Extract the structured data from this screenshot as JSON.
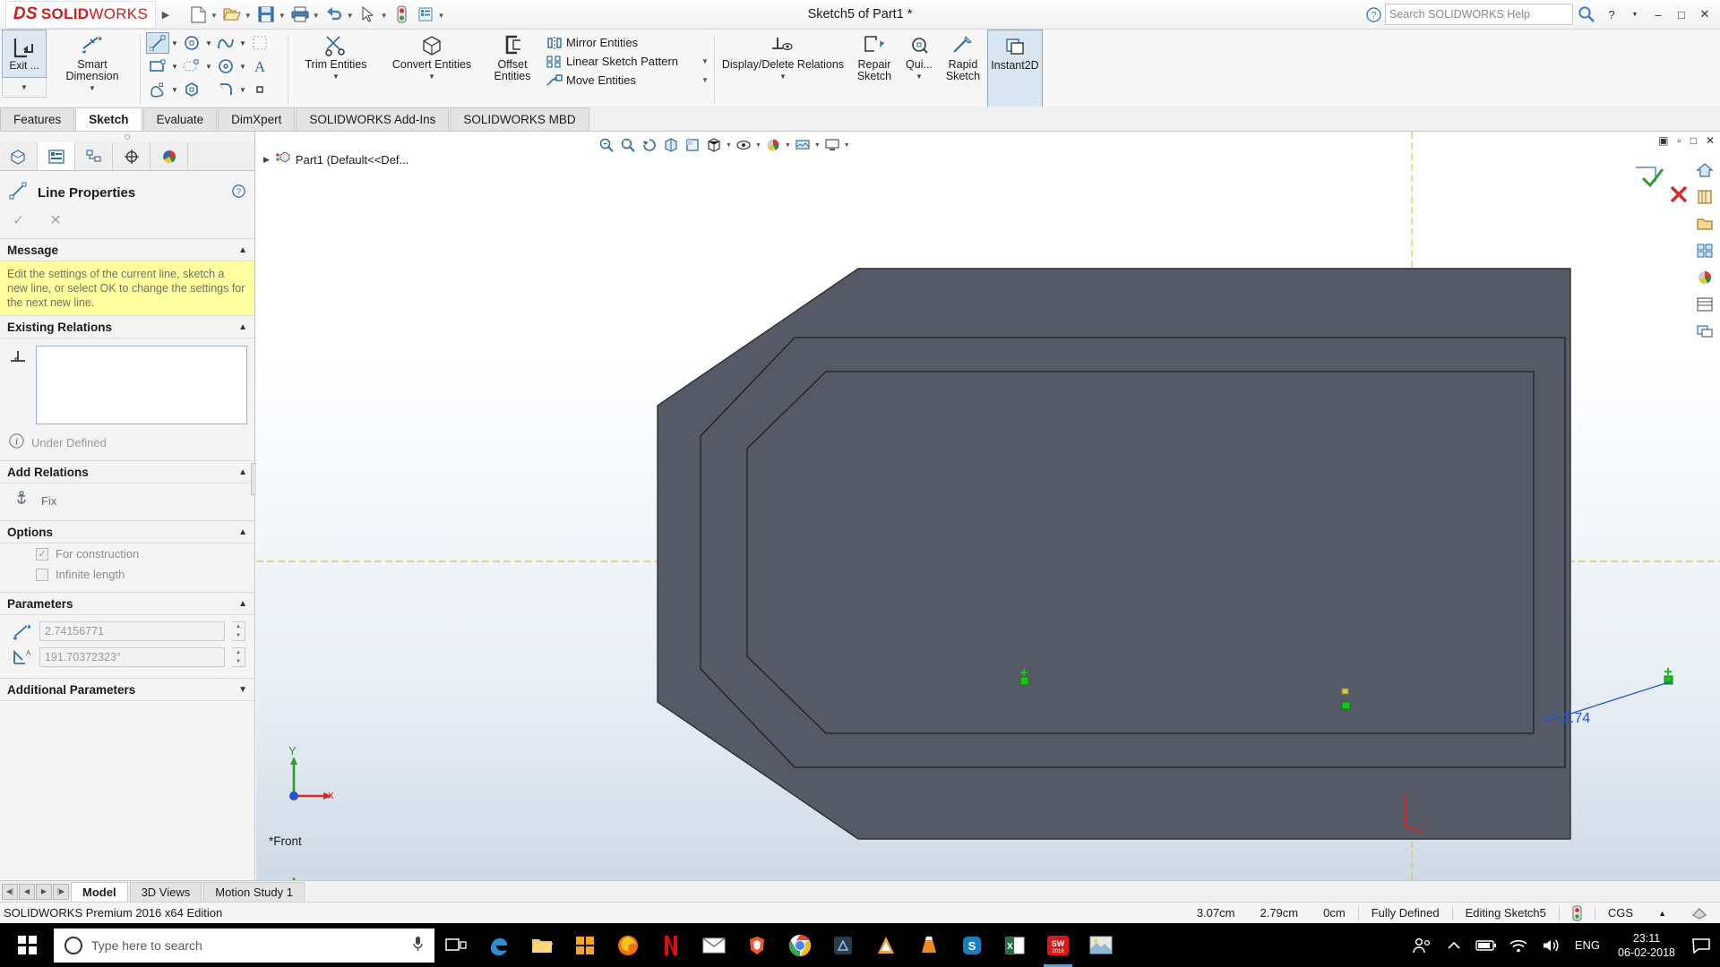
{
  "titlebar": {
    "logo_ds": "DS",
    "logo_solid": "SOLID",
    "logo_works": "WORKS",
    "document_title": "Sketch5 of Part1 *",
    "search_placeholder": "Search SOLIDWORKS Help",
    "qat": [
      {
        "name": "new-document",
        "glyph": "὜B"
      },
      {
        "name": "open-document",
        "glyph": "Ὄ2"
      },
      {
        "name": "save-document",
        "glyph": "ὋE"
      },
      {
        "name": "print-document",
        "glyph": "὚8"
      },
      {
        "name": "undo",
        "glyph": "↶"
      },
      {
        "name": "select",
        "glyph": "↖"
      },
      {
        "name": "rebuild",
        "glyph": "Ὢ6"
      },
      {
        "name": "options",
        "glyph": "⚙"
      }
    ],
    "window_controls": [
      "?",
      "−",
      "□",
      "✕"
    ]
  },
  "ribbon": {
    "exit_sketch": "Exit ...",
    "smart_dimension": "Smart Dimension",
    "trim_entities": "Trim Entities",
    "convert_entities": "Convert Entities",
    "offset_entities": "Offset Entities",
    "mirror_entities": "Mirror Entities",
    "linear_sketch_pattern": "Linear Sketch Pattern",
    "move_entities": "Move Entities",
    "display_delete_relations": "Display/Delete Relations",
    "repair_sketch": "Repair Sketch",
    "quick_snaps": "Qui...",
    "rapid_sketch": "Rapid Sketch",
    "instant2d": "Instant2D"
  },
  "tabs": {
    "items": [
      {
        "label": "Features",
        "active": false
      },
      {
        "label": "Sketch",
        "active": true
      },
      {
        "label": "Evaluate",
        "active": false
      },
      {
        "label": "DimXpert",
        "active": false
      },
      {
        "label": "SOLIDWORKS Add-Ins",
        "active": false
      },
      {
        "label": "SOLIDWORKS MBD",
        "active": false
      }
    ]
  },
  "property_manager": {
    "title": "Line Properties",
    "message_section": "Message",
    "message_text": "Edit the settings of the current line, sketch a new line, or select OK to change the settings for the next new line.",
    "existing_relations_section": "Existing Relations",
    "status_text": "Under Defined",
    "add_relations_section": "Add Relations",
    "fix_label": "Fix",
    "options_section": "Options",
    "for_construction_label": "For construction",
    "for_construction_checked": true,
    "infinite_length_label": "Infinite length",
    "infinite_length_checked": false,
    "parameters_section": "Parameters",
    "length_value": "2.74156771",
    "angle_value": "191.70372323°",
    "additional_parameters_section": "Additional Parameters"
  },
  "graphics": {
    "feature_tree_item": "Part1  (Default<<Def...",
    "plane_label": "*Front",
    "dimension_label": "2.74",
    "axis_x": "x",
    "axis_y": "Y"
  },
  "bottom_tabs": {
    "items": [
      {
        "label": "Model",
        "active": true
      },
      {
        "label": "3D Views",
        "active": false
      },
      {
        "label": "Motion Study 1",
        "active": false
      }
    ]
  },
  "statusbar": {
    "edition": "SOLIDWORKS Premium 2016 x64 Edition",
    "coord_x": "3.07cm",
    "coord_y": "2.79cm",
    "coord_z": "0cm",
    "definition_state": "Fully Defined",
    "editing_state": "Editing Sketch5",
    "units": "CGS"
  },
  "taskbar": {
    "search_placeholder": "Type here to search",
    "language": "ENG",
    "time": "23:11",
    "date": "06-02-2018",
    "apps": [
      {
        "name": "task-view"
      },
      {
        "name": "edge-browser"
      },
      {
        "name": "file-explorer"
      },
      {
        "name": "microsoft-store"
      },
      {
        "name": "firefox-browser"
      },
      {
        "name": "netflix"
      },
      {
        "name": "mail"
      },
      {
        "name": "brave-browser"
      },
      {
        "name": "chrome-browser"
      },
      {
        "name": "autodesk-app"
      },
      {
        "name": "ansys-app"
      },
      {
        "name": "vlc-player"
      },
      {
        "name": "skype"
      },
      {
        "name": "excel"
      },
      {
        "name": "solidworks"
      },
      {
        "name": "photos"
      }
    ]
  },
  "colors": {
    "accent": "#d61a1a",
    "model_fill": "#555a66",
    "selection_blue": "#2255cc",
    "message_bg": "#ffffa0",
    "taskbar_bg": "#000000"
  }
}
